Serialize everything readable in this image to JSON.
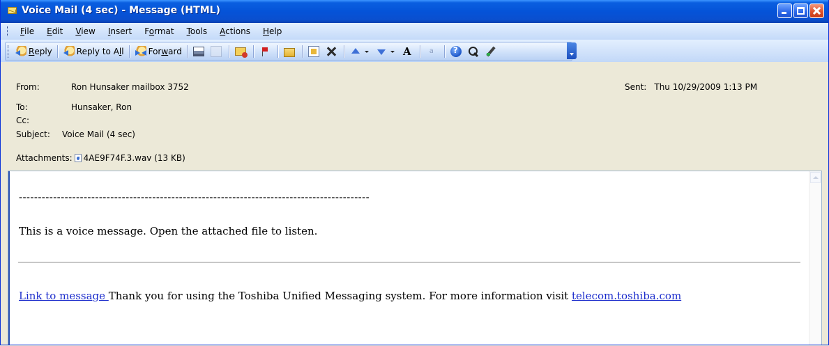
{
  "window": {
    "title": "Voice Mail (4 sec) - Message (HTML)"
  },
  "menu": [
    {
      "label_pre": "",
      "accel": "F",
      "label_post": "ile"
    },
    {
      "label_pre": "",
      "accel": "E",
      "label_post": "dit"
    },
    {
      "label_pre": "",
      "accel": "V",
      "label_post": "iew"
    },
    {
      "label_pre": "",
      "accel": "I",
      "label_post": "nsert"
    },
    {
      "label_pre": "F",
      "accel": "o",
      "label_post": "rmat"
    },
    {
      "label_pre": "",
      "accel": "T",
      "label_post": "ools"
    },
    {
      "label_pre": "",
      "accel": "A",
      "label_post": "ctions"
    },
    {
      "label_pre": "",
      "accel": "H",
      "label_post": "elp"
    }
  ],
  "toolbar": {
    "reply_pre": "",
    "reply_accel": "R",
    "reply_post": "eply",
    "reply_all_pre": "Reply to A",
    "reply_all_accel": "l",
    "reply_all_post": "l",
    "forward_pre": "For",
    "forward_accel": "w",
    "forward_post": "ard",
    "font_glyph": "A",
    "encode_glyph": "a"
  },
  "header": {
    "from_label": "From:",
    "from_value": "Ron Hunsaker mailbox 3752",
    "to_label": "To:",
    "to_value": "Hunsaker, Ron",
    "cc_label": "Cc:",
    "cc_value": "",
    "subject_label": "Subject:",
    "subject_value": "Voice Mail (4 sec)",
    "sent_label": "Sent:",
    "sent_value": "Thu 10/29/2009 1:13 PM",
    "attachments_label": "Attachments:",
    "attachment_name": "4AE9F74F.3.wav (13 KB)"
  },
  "body": {
    "divider": "--------------------------------------------------------------------------------------------",
    "message": "This is a voice message. Open the attached file to listen.",
    "link_text": "Link to message ",
    "footer_text": "Thank you for using the Toshiba Unified Messaging system. For more information visit ",
    "website_link": "telecom.toshiba.com"
  },
  "colors": {
    "titlebar": "#0553d8",
    "link": "#1b2ccc",
    "header_bg": "#ece9d8"
  },
  "icons": [
    "envelope-icon",
    "reply-icon",
    "reply-all-icon",
    "forward-icon",
    "print-icon",
    "copy-icon",
    "mail-icon",
    "flag-icon",
    "folder-icon",
    "move-icon",
    "delete-icon",
    "previous-icon",
    "next-icon",
    "font-size-icon",
    "encoding-icon",
    "help-icon",
    "find-icon",
    "ink-icon",
    "wav-file-icon"
  ]
}
